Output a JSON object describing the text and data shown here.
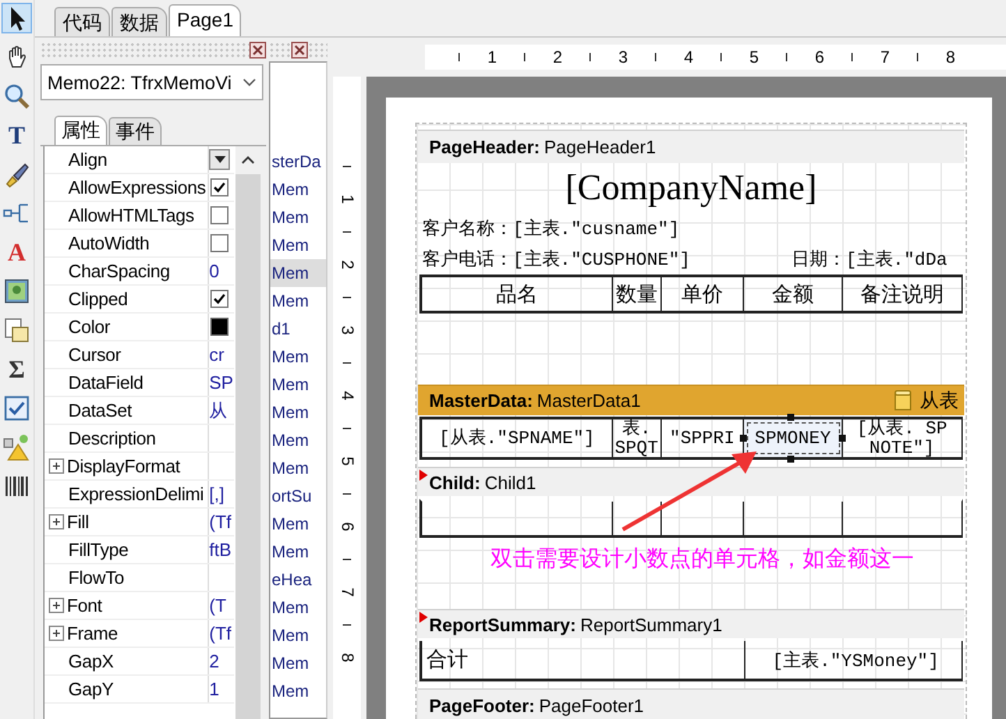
{
  "toolbar": [
    {
      "kind": "pointer",
      "selected": true
    },
    {
      "kind": "hand",
      "selected": false
    },
    {
      "kind": "zoom",
      "selected": false
    },
    {
      "kind": "glyph",
      "glyph": "T",
      "color": "#1f3d7a",
      "selected": false
    },
    {
      "kind": "brush",
      "selected": false
    },
    {
      "kind": "connector",
      "selected": false
    },
    {
      "kind": "glyph",
      "glyph": "A",
      "color": "#d32f2f",
      "selected": false
    },
    {
      "kind": "picture",
      "selected": false
    },
    {
      "kind": "pages",
      "selected": false
    },
    {
      "kind": "glyph",
      "glyph": "Σ",
      "color": "#333333",
      "selected": false
    },
    {
      "kind": "checkbox",
      "selected": false
    },
    {
      "kind": "shapes",
      "selected": false
    },
    {
      "kind": "barcode",
      "selected": false
    }
  ],
  "tabs": [
    {
      "label": "代码",
      "selected": false
    },
    {
      "label": "数据",
      "selected": false
    },
    {
      "label": "Page1",
      "selected": true
    }
  ],
  "inspector": {
    "object": "Memo22: TfrxMemoVi",
    "tabs": [
      {
        "label": "属性",
        "selected": true
      },
      {
        "label": "事件",
        "selected": false
      }
    ],
    "properties": [
      {
        "name": "Align",
        "kind": "dropdown",
        "expandable": false
      },
      {
        "name": "AllowExpressions",
        "kind": "checkbox",
        "checked": true,
        "expandable": false
      },
      {
        "name": "AllowHTMLTags",
        "kind": "checkbox",
        "checked": false,
        "expandable": false
      },
      {
        "name": "AutoWidth",
        "kind": "checkbox",
        "checked": false,
        "expandable": false
      },
      {
        "name": "CharSpacing",
        "kind": "text",
        "value": "0",
        "expandable": false
      },
      {
        "name": "Clipped",
        "kind": "checkbox",
        "checked": true,
        "expandable": false
      },
      {
        "name": "Color",
        "kind": "color",
        "color": "#000000",
        "expandable": false
      },
      {
        "name": "Cursor",
        "kind": "text",
        "value": "cr",
        "expandable": false
      },
      {
        "name": "DataField",
        "kind": "text",
        "value": "SP",
        "expandable": false
      },
      {
        "name": "DataSet",
        "kind": "text",
        "value": "从",
        "expandable": false
      },
      {
        "name": "Description",
        "kind": "text",
        "expandable": false
      },
      {
        "name": "DisplayFormat",
        "kind": "text",
        "expandable": true
      },
      {
        "name": "ExpressionDelimi",
        "kind": "text",
        "value": "[,]",
        "expandable": false
      },
      {
        "name": "Fill",
        "kind": "text",
        "value": "(Tf",
        "expandable": true
      },
      {
        "name": "FillType",
        "kind": "text",
        "value": "ftB",
        "expandable": false
      },
      {
        "name": "FlowTo",
        "kind": "text",
        "expandable": false
      },
      {
        "name": "Font",
        "kind": "text",
        "value": "(T",
        "expandable": true
      },
      {
        "name": "Frame",
        "kind": "text",
        "value": "(Tf",
        "expandable": true
      },
      {
        "name": "GapX",
        "kind": "text",
        "value": "2",
        "expandable": false
      },
      {
        "name": "GapY",
        "kind": "text",
        "value": "1",
        "expandable": false
      }
    ]
  },
  "tree": {
    "items": [
      {
        "label": "sterDa",
        "selected": false
      },
      {
        "label": "Mem",
        "selected": false
      },
      {
        "label": "Mem",
        "selected": false
      },
      {
        "label": "Mem",
        "selected": false
      },
      {
        "label": "Mem",
        "selected": true
      },
      {
        "label": "Mem",
        "selected": false
      },
      {
        "label": "d1",
        "selected": false
      },
      {
        "label": "Mem",
        "selected": false
      },
      {
        "label": "Mem",
        "selected": false
      },
      {
        "label": "Mem",
        "selected": false
      },
      {
        "label": "Mem",
        "selected": false
      },
      {
        "label": "Mem",
        "selected": false
      },
      {
        "label": "ortSu",
        "selected": false
      },
      {
        "label": "Mem",
        "selected": false
      },
      {
        "label": "Mem",
        "selected": false
      },
      {
        "label": "eHea",
        "selected": false
      },
      {
        "label": "Mem",
        "selected": false
      },
      {
        "label": "Mem",
        "selected": false
      },
      {
        "label": "Mem",
        "selected": false
      },
      {
        "label": "Mem",
        "selected": false
      }
    ]
  },
  "rulers": {
    "horizontal": [
      "1",
      "2",
      "3",
      "4",
      "5",
      "6",
      "7",
      "8"
    ],
    "vertical": [
      "1",
      "2",
      "3",
      "4",
      "5",
      "6",
      "7",
      "8"
    ]
  },
  "report": {
    "page_header": {
      "type": "PageHeader:",
      "name": "PageHeader1",
      "marker": false,
      "company": "[CompanyName]",
      "customer": "客户名称：[主表.\"cusname\"]",
      "phone": "客户电话：[主表.\"CUSPHONE\"]",
      "date": "日期：[主表.\"dDa",
      "columns": [
        "品名",
        "数量",
        "单价",
        "金额",
        "备注说明"
      ]
    },
    "master_data": {
      "type": "MasterData:",
      "name": "MasterData1",
      "marker": false,
      "dataset": "从表",
      "cells": [
        {
          "text": "[从表.\"SPNAME\"]",
          "selected": false
        },
        {
          "text": "表.\nSPQT",
          "selected": false
        },
        {
          "text": "\"SPPRI",
          "selected": false
        },
        {
          "text": "SPMONEY",
          "selected": true
        },
        {
          "text": "[从表. SP\nNOTE\"]",
          "selected": false
        }
      ]
    },
    "child": {
      "type": "Child:",
      "name": "Child1",
      "marker": true
    },
    "summary": {
      "type": "ReportSummary:",
      "name": "ReportSummary1",
      "marker": true,
      "label": "合计",
      "total": "[主表.\"YSMoney\"]"
    },
    "page_footer": {
      "type": "PageFooter:",
      "name": "PageFooter1",
      "marker": false
    }
  },
  "annotation": "双击需要设计小数点的单元格，如金额这一"
}
